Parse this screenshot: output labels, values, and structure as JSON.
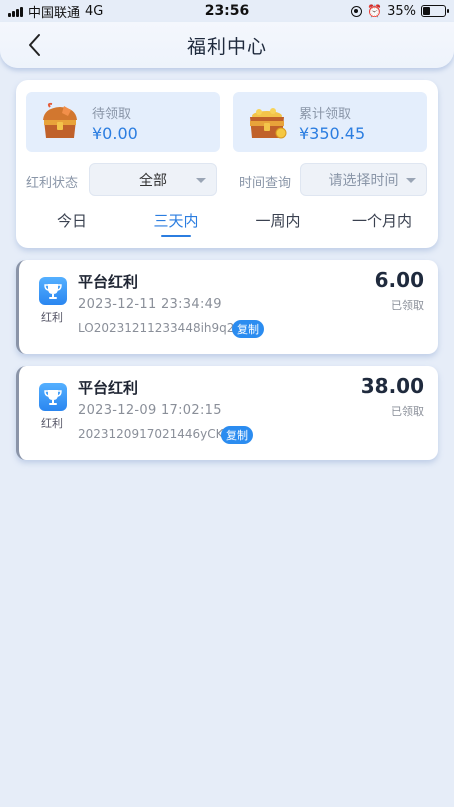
{
  "status_bar": {
    "carrier": "中国联通",
    "network": "4G",
    "time": "23:56",
    "battery": "35%",
    "battery_level": 0.35
  },
  "header": {
    "title": "福利中心",
    "back_icon": "chevron-left-icon"
  },
  "summary": {
    "pending_label": "待领取",
    "pending_value": "¥0.00",
    "pending_icon": "treasure-chest-icon",
    "total_label": "累计领取",
    "total_value": "¥350.45",
    "total_icon": "treasure-chest-coins-icon"
  },
  "filters": {
    "status_label": "红利状态",
    "status_value": "全部",
    "time_label": "时间查询",
    "time_placeholder": "请选择时间"
  },
  "tabs": [
    {
      "label": "今日",
      "active": false
    },
    {
      "label": "三天内",
      "active": true
    },
    {
      "label": "一周内",
      "active": false
    },
    {
      "label": "一个月内",
      "active": false
    }
  ],
  "records": [
    {
      "icon": "trophy-icon",
      "icon_label": "红利",
      "title": "平台红利",
      "time": "2023-12-11 23:34:49",
      "order_no": "LO20231211233448ih9q2",
      "copy_label": "复制",
      "amount": "6.00",
      "status": "已领取"
    },
    {
      "icon": "trophy-icon",
      "icon_label": "红利",
      "title": "平台红利",
      "time": "2023-12-09 17:02:15",
      "order_no": "2023120917021446yCK",
      "copy_label": "复制",
      "amount": "38.00",
      "status": "已领取"
    }
  ],
  "colors": {
    "accent": "#2b7de0",
    "background": "#e6edf8",
    "card": "#ffffff",
    "stat_box": "#e4eefc"
  }
}
